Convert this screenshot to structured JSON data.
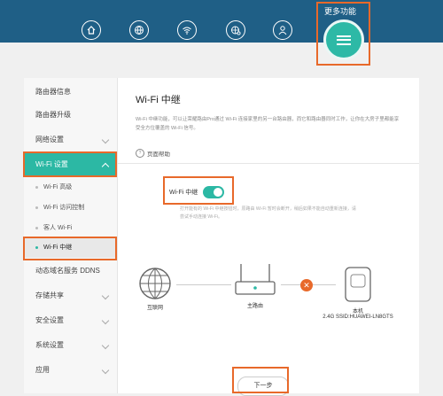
{
  "topbar": {
    "icons": [
      "home-icon",
      "globe-icon",
      "wifi-icon",
      "settings-globe-icon",
      "user-icon"
    ],
    "more_label": "更多功能",
    "more_icon": "menu-icon"
  },
  "sidebar": {
    "items": [
      {
        "label": "路由器信息"
      },
      {
        "label": "路由器升级"
      },
      {
        "label": "网络设置"
      },
      {
        "label": "Wi-Fi 设置"
      },
      {
        "label": "动态域名服务 DDNS"
      },
      {
        "label": "存储共享"
      },
      {
        "label": "安全设置"
      },
      {
        "label": "系统设置"
      },
      {
        "label": "应用"
      }
    ],
    "sub_items": [
      {
        "label": "Wi-Fi 高级"
      },
      {
        "label": "Wi-Fi 访问控制"
      },
      {
        "label": "客人 Wi-Fi"
      },
      {
        "label": "Wi-Fi 中继"
      }
    ]
  },
  "main": {
    "title": "Wi-Fi 中继",
    "description": "Wi-Fi 中继功能，可以让荣耀路由Pro通过 Wi-Fi 连接家里的另一台路由器，而它和路由器同时工作，让你在大房子里都能享受全方位覆盖的 Wi-Fi 信号。",
    "help_label": "页面帮助",
    "toggle_label": "Wi-Fi 中继",
    "toggle_on": true,
    "hint": "打开能有的 Wi-Fi 中继按钮时，原路由 Wi-Fi 暂时会断开，稍后如果不能自动重新连接，请尝试手动连接 Wi-Fi。",
    "devices": {
      "internet": "互联网",
      "main_router": "主路由",
      "this_device": "本机",
      "ssid": "2.4G SSID:HUAWEI-LN8GTS"
    },
    "next_button": "下一步"
  },
  "colors": {
    "topbar": "#1f5f86",
    "accent": "#2cb8a4",
    "highlight": "#e8692a"
  }
}
